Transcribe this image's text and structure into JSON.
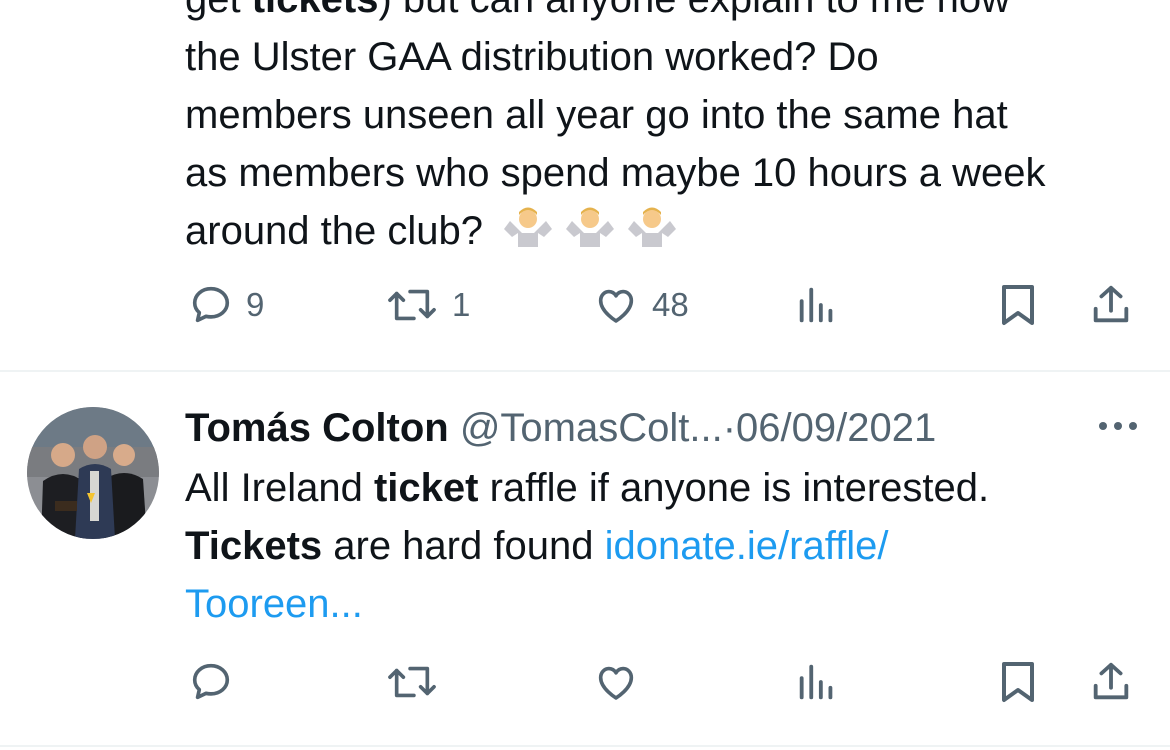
{
  "tweet1": {
    "line0_pre": "get ",
    "line0_bold": "tickets",
    "line0_post": ") but can anyone explain to me how",
    "line1": "the Ulster GAA distribution worked? Do",
    "line2": "members unseen all year go into the same hat",
    "line3": "as members who spend maybe 10 hours a week",
    "line4": "around the club?",
    "emojis": [
      "person-shrugging",
      "person-shrugging",
      "person-shrugging"
    ],
    "actions": {
      "replies": "9",
      "retweets": "1",
      "likes": "48"
    }
  },
  "tweet2": {
    "author_name": "Tomás Colton",
    "handle": "@TomasColt...",
    "separator": "·",
    "date": "06/09/2021",
    "text_a": "All Ireland ",
    "text_b": "ticket",
    "text_c": " raffle if anyone is interested.",
    "text_d": "Tickets",
    "text_e": " are hard found ",
    "link_1": "idonate.ie/raffle/",
    "link_2": "Tooreen...",
    "actions": {
      "replies": "",
      "retweets": "",
      "likes": ""
    }
  },
  "colors": {
    "text": "#0f1419",
    "muted": "#536471",
    "link": "#1d9bf0",
    "divider": "#eff3f4"
  },
  "icons": [
    "reply-icon",
    "retweet-icon",
    "like-icon",
    "views-icon",
    "bookmark-icon",
    "share-icon",
    "more-icon"
  ]
}
